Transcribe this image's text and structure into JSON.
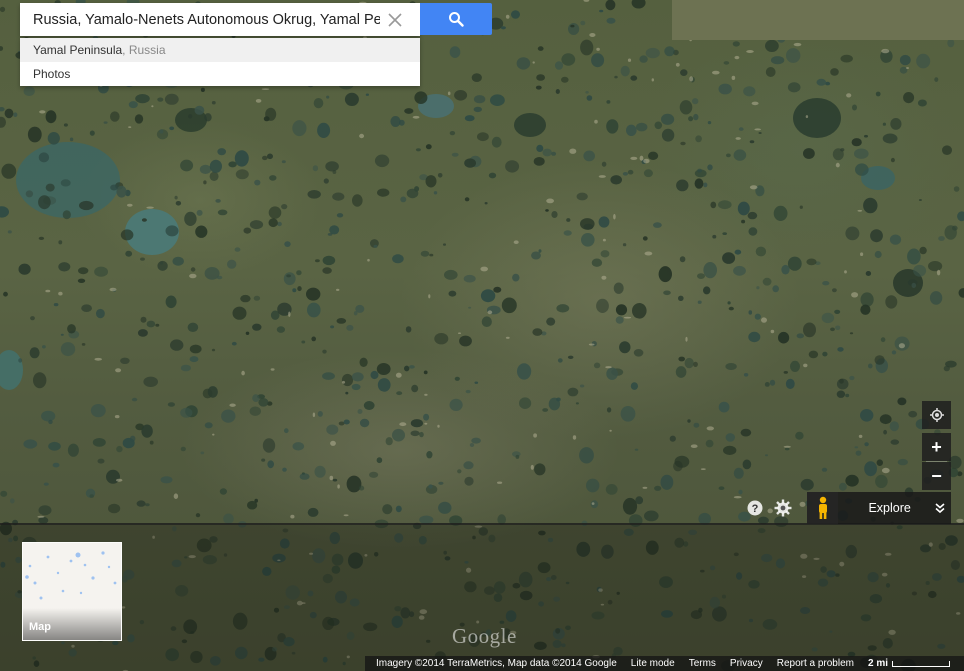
{
  "search": {
    "query": "Russia, Yamalo-Nenets Autonomous Okrug, Yamal Peninsula",
    "clear_icon": "close-icon",
    "search_icon": "search-icon"
  },
  "suggestions": [
    {
      "primary": "Yamal Peninsula",
      "secondary": ", Russia"
    },
    {
      "primary": "Photos",
      "secondary": ""
    }
  ],
  "controls": {
    "location_icon": "my-location-icon",
    "zoom_in": "+",
    "zoom_out": "−",
    "help_icon": "help-icon",
    "settings_icon": "gear-icon"
  },
  "explore": {
    "label": "Explore",
    "pegman_icon": "pegman-icon",
    "chevron_icon": "double-chevron-down-icon"
  },
  "map_thumb": {
    "label": "Map"
  },
  "logo": "Google",
  "attribution": {
    "imagery": "Imagery ©2014 TerraMetrics, Map data ©2014 Google",
    "lite_mode": "Lite mode",
    "terms": "Terms",
    "privacy": "Privacy",
    "report": "Report a problem",
    "scale": "2 mi"
  },
  "colors": {
    "search_button": "#4285f4",
    "pegman": "#f5b400",
    "terrain": "#55603f",
    "lake": "#2e4a3c"
  }
}
